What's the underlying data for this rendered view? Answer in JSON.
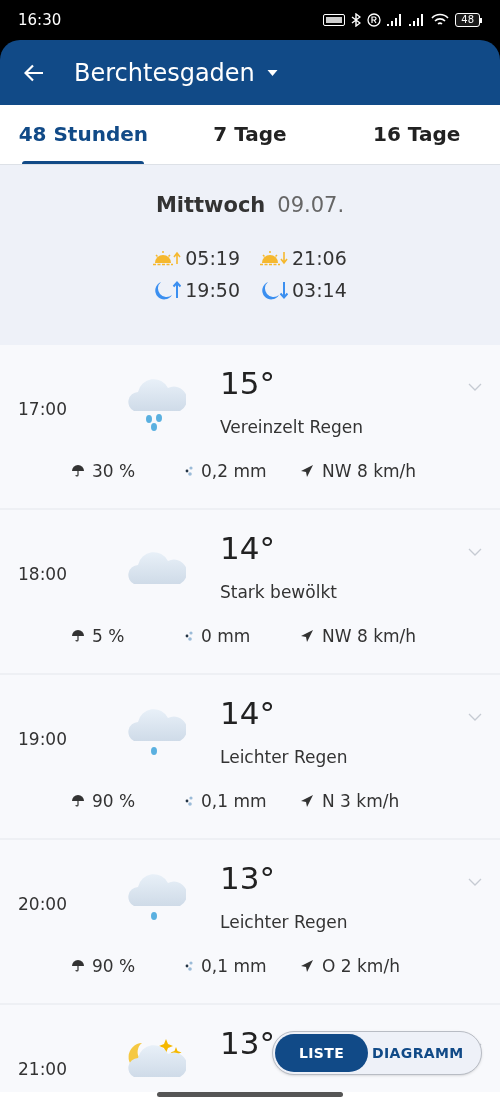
{
  "status_bar": {
    "time": "16:30",
    "battery": "48"
  },
  "header": {
    "title": "Berchtesgaden"
  },
  "tabs": [
    {
      "label": "48 Stunden",
      "selected": true
    },
    {
      "label": "7 Tage",
      "selected": false
    },
    {
      "label": "16 Tage",
      "selected": false
    }
  ],
  "day": {
    "weekday": "Mittwoch",
    "date": "09.07.",
    "sunrise": "05:19",
    "sunset": "21:06",
    "moonrise": "19:50",
    "moonset": "03:14"
  },
  "hours": [
    {
      "time": "17:00",
      "kind": "rain",
      "temperature": "15°",
      "condition": "Vereinzelt Regen",
      "rain_chance": "30 %",
      "rain_amount": "0,2 mm",
      "wind": "NW 8 km/h"
    },
    {
      "time": "18:00",
      "kind": "cloud",
      "temperature": "14°",
      "condition": "Stark bewölkt",
      "rain_chance": "5 %",
      "rain_amount": "0 mm",
      "wind": "NW 8 km/h"
    },
    {
      "time": "19:00",
      "kind": "drizzle",
      "temperature": "14°",
      "condition": "Leichter Regen",
      "rain_chance": "90 %",
      "rain_amount": "0,1 mm",
      "wind": "N 3 km/h"
    },
    {
      "time": "20:00",
      "kind": "drizzle",
      "temperature": "13°",
      "condition": "Leichter Regen",
      "rain_chance": "90 %",
      "rain_amount": "0,1 mm",
      "wind": "O 2 km/h"
    },
    {
      "time": "21:00",
      "kind": "night",
      "temperature": "13°"
    }
  ],
  "view_toggle": [
    {
      "label": "LISTE",
      "selected": true
    },
    {
      "label": "DIAGRAMM",
      "selected": false
    }
  ]
}
